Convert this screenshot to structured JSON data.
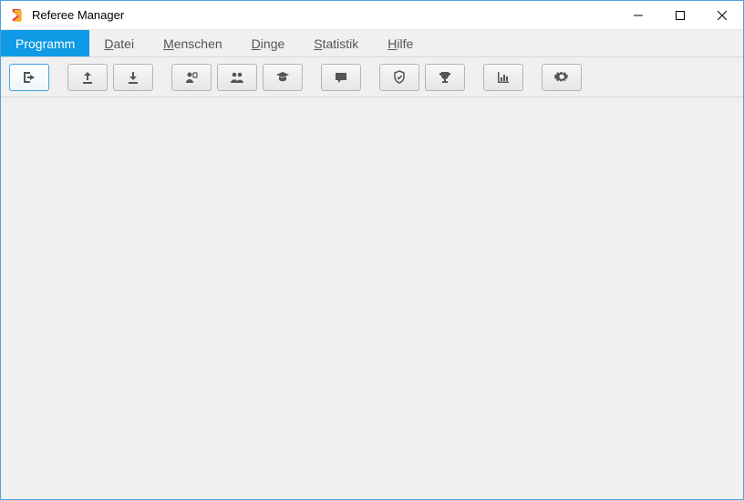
{
  "window": {
    "title": "Referee Manager"
  },
  "menu": {
    "items": [
      {
        "label": "Programm",
        "mnemonic": 0,
        "active": true
      },
      {
        "label": "Datei",
        "mnemonic": 0,
        "active": false
      },
      {
        "label": "Menschen",
        "mnemonic": 0,
        "active": false
      },
      {
        "label": "Dinge",
        "mnemonic": 0,
        "active": false
      },
      {
        "label": "Statistik",
        "mnemonic": 0,
        "active": false
      },
      {
        "label": "Hilfe",
        "mnemonic": 0,
        "active": false
      }
    ]
  },
  "toolbar": {
    "groups": [
      [
        {
          "name": "exit-button",
          "icon": "exit-icon",
          "selected": true
        }
      ],
      [
        {
          "name": "upload-button",
          "icon": "upload-icon",
          "selected": false
        },
        {
          "name": "download-button",
          "icon": "download-icon",
          "selected": false
        }
      ],
      [
        {
          "name": "referees-button",
          "icon": "referee-icon",
          "selected": false
        },
        {
          "name": "people-button",
          "icon": "people-icon",
          "selected": false
        },
        {
          "name": "trainees-button",
          "icon": "graduate-icon",
          "selected": false
        }
      ],
      [
        {
          "name": "messages-button",
          "icon": "message-icon",
          "selected": false
        }
      ],
      [
        {
          "name": "leagues-button",
          "icon": "shield-icon",
          "selected": false
        },
        {
          "name": "tournaments-button",
          "icon": "trophy-icon",
          "selected": false
        }
      ],
      [
        {
          "name": "statistics-button",
          "icon": "chart-icon",
          "selected": false
        }
      ],
      [
        {
          "name": "settings-button",
          "icon": "gear-icon",
          "selected": false
        }
      ]
    ]
  }
}
